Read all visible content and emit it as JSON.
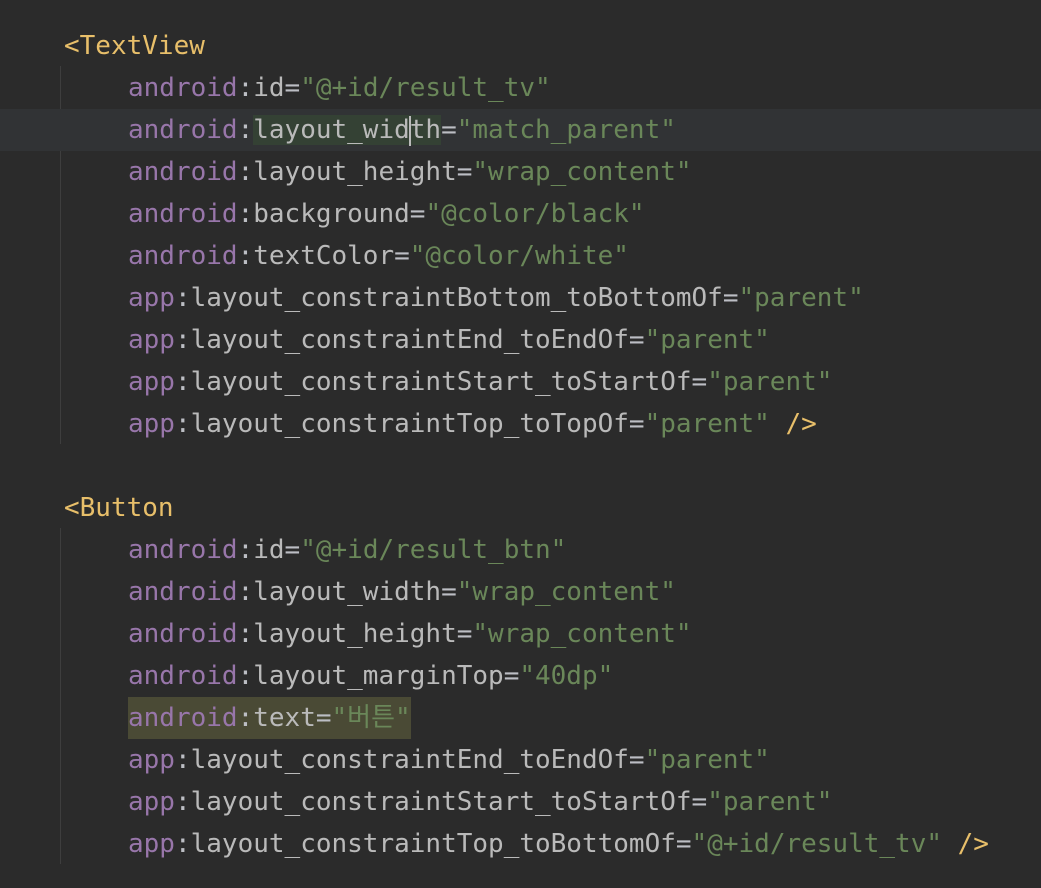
{
  "editor": {
    "textview": {
      "open": "<TextView",
      "attrs": [
        {
          "ns": "android",
          "name": "id",
          "value": "\"@+id/result_tv\""
        },
        {
          "ns": "android",
          "name": "layout_width",
          "value": "\"match_parent\""
        },
        {
          "ns": "android",
          "name": "layout_height",
          "value": "\"wrap_content\""
        },
        {
          "ns": "android",
          "name": "background",
          "value": "\"@color/black\""
        },
        {
          "ns": "android",
          "name": "textColor",
          "value": "\"@color/white\""
        },
        {
          "ns": "app",
          "name": "layout_constraintBottom_toBottomOf",
          "value": "\"parent\""
        },
        {
          "ns": "app",
          "name": "layout_constraintEnd_toEndOf",
          "value": "\"parent\""
        },
        {
          "ns": "app",
          "name": "layout_constraintStart_toStartOf",
          "value": "\"parent\""
        },
        {
          "ns": "app",
          "name": "layout_constraintTop_toTopOf",
          "value": "\"parent\""
        }
      ],
      "close": "/>"
    },
    "button": {
      "open": "<Button",
      "attrs": [
        {
          "ns": "android",
          "name": "id",
          "value": "\"@+id/result_btn\""
        },
        {
          "ns": "android",
          "name": "layout_width",
          "value": "\"wrap_content\""
        },
        {
          "ns": "android",
          "name": "layout_height",
          "value": "\"wrap_content\""
        },
        {
          "ns": "android",
          "name": "layout_marginTop",
          "value": "\"40dp\""
        },
        {
          "ns": "android",
          "name": "text",
          "value": "\"버튼\""
        },
        {
          "ns": "app",
          "name": "layout_constraintEnd_toEndOf",
          "value": "\"parent\""
        },
        {
          "ns": "app",
          "name": "layout_constraintStart_toStartOf",
          "value": "\"parent\""
        },
        {
          "ns": "app",
          "name": "layout_constraintTop_toBottomOf",
          "value": "\"@+id/result_tv\""
        }
      ],
      "close": "/>"
    },
    "syntax_colors": {
      "background": "#2b2b2b",
      "tag": "#e8bf6a",
      "namespace": "#9876aa",
      "attribute": "#bababa",
      "string": "#6a8759"
    }
  }
}
